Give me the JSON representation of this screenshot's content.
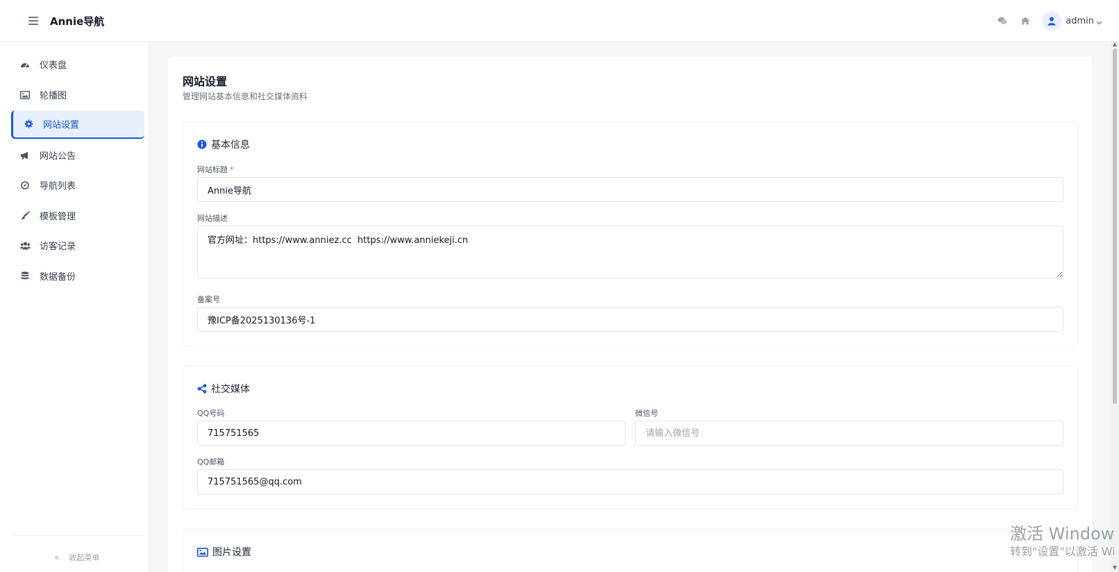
{
  "app": {
    "title": "Annie导航"
  },
  "header": {
    "username": "admin",
    "icons": {
      "menu": "hamburger-icon",
      "chat": "chat-bubbles-icon",
      "home": "home-icon",
      "avatar": "user-icon",
      "caret": "chevron-down-icon"
    }
  },
  "sidebar": {
    "items": [
      {
        "label": "仪表盘",
        "icon": "dashboard-icon",
        "active": false
      },
      {
        "label": "轮播图",
        "icon": "image-icon",
        "active": false
      },
      {
        "label": "网站设置",
        "icon": "gear-icon",
        "active": true
      },
      {
        "label": "网站公告",
        "icon": "megaphone-icon",
        "active": false
      },
      {
        "label": "导航列表",
        "icon": "compass-icon",
        "active": false
      },
      {
        "label": "模板管理",
        "icon": "paintbrush-icon",
        "active": false
      },
      {
        "label": "访客记录",
        "icon": "users-icon",
        "active": false
      },
      {
        "label": "数据备份",
        "icon": "database-icon",
        "active": false
      }
    ],
    "collapse_label": "收起菜单",
    "collapse_glyph": "«"
  },
  "page": {
    "title": "网站设置",
    "subtitle": "管理网站基本信息和社交媒体资料"
  },
  "basic": {
    "title": "基本信息",
    "site_title_label": "网站标题",
    "required_mark": "*",
    "site_title_value": "Annie导航",
    "desc_label": "网站描述",
    "desc_value": "官方网址：https://www.anniez.cc  https://www.anniekeji.cn",
    "icp_label": "备案号",
    "icp_value": "豫ICP备2025130136号-1"
  },
  "social": {
    "title": "社交媒体",
    "qq_label": "QQ号码",
    "qq_value": "715751565",
    "wechat_label": "微信号",
    "wechat_value": "",
    "wechat_placeholder": "请输入微信号",
    "email_label": "QQ邮箱",
    "email_value": "715751565@qq.com"
  },
  "image": {
    "title": "图片设置"
  },
  "colors": {
    "accent": "#1a56db",
    "active_bg": "#e8f0fe",
    "required": "#ef4444"
  },
  "watermark": {
    "line1": "激活 Windows",
    "line2": "转到\"设置\"以激活 Windows。"
  }
}
